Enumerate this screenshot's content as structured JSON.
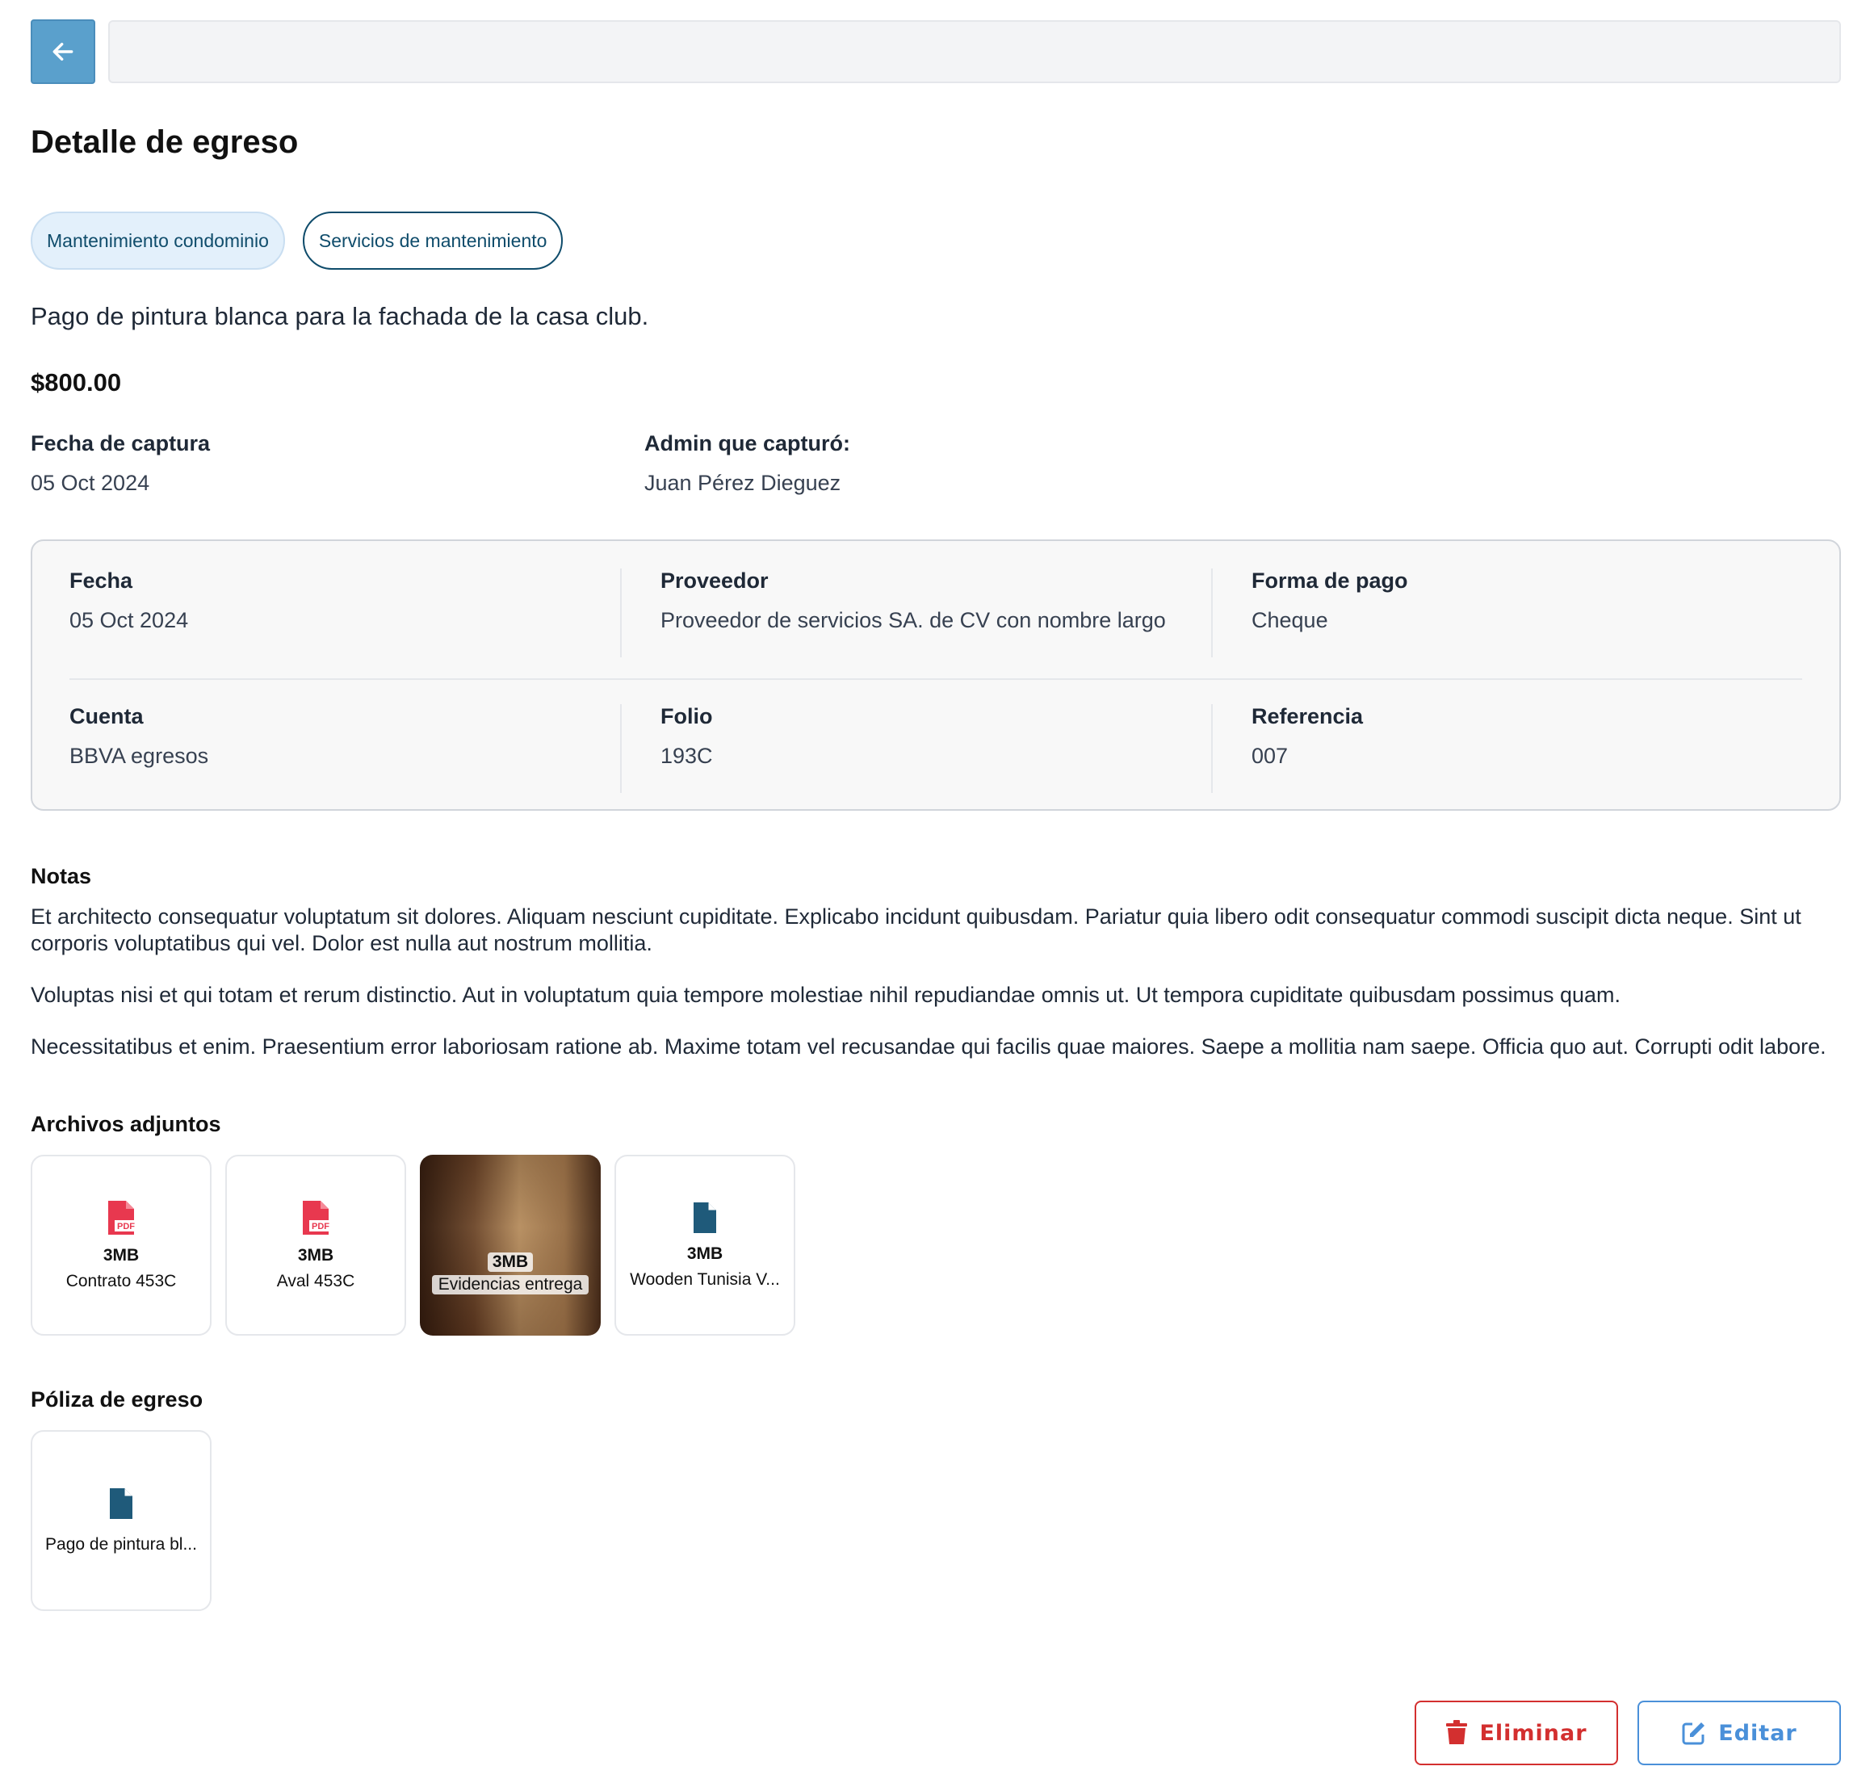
{
  "header": {
    "back_icon": "arrow-left-icon",
    "search_value": ""
  },
  "page_title": "Detalle de egreso",
  "chips": [
    {
      "label": "Mantenimiento condominio"
    },
    {
      "label": "Servicios de mantenimiento"
    }
  ],
  "description": "Pago de pintura blanca para la fachada de la casa club.",
  "amount": "$800.00",
  "meta": {
    "capture_date_label": "Fecha de captura",
    "capture_date_value": "05 Oct 2024",
    "admin_label": "Admin que capturó:",
    "admin_value": "Juan Pérez Dieguez"
  },
  "details": {
    "fecha_label": "Fecha",
    "fecha_value": "05 Oct 2024",
    "proveedor_label": "Proveedor",
    "proveedor_value": "Proveedor de servicios SA. de CV con nombre largo",
    "forma_pago_label": "Forma de pago",
    "forma_pago_value": "Cheque",
    "cuenta_label": "Cuenta",
    "cuenta_value": "BBVA egresos",
    "folio_label": "Folio",
    "folio_value": "193C",
    "referencia_label": "Referencia",
    "referencia_value": "007"
  },
  "notes": {
    "title": "Notas",
    "paragraphs": [
      "Et architecto consequatur voluptatum sit dolores. Aliquam nesciunt cupiditate. Explicabo incidunt quibusdam. Pariatur quia libero odit consequatur commodi suscipit dicta neque. Sint ut corporis voluptatibus qui vel. Dolor est nulla aut nostrum mollitia.",
      "Voluptas nisi et qui totam et rerum distinctio. Aut in voluptatum quia tempore molestiae nihil repudiandae omnis ut. Ut tempora cupiditate quibusdam possimus quam.",
      "Necessitatibus et enim. Praesentium error laboriosam ratione ab. Maxime totam vel recusandae qui facilis quae maiores. Saepe a mollitia nam saepe. Officia quo aut. Corrupti odit labore."
    ]
  },
  "attachments": {
    "title": "Archivos adjuntos",
    "files": [
      {
        "size": "3MB",
        "name": "Contrato 453C",
        "icon": "pdf-icon"
      },
      {
        "size": "3MB",
        "name": "Aval 453C",
        "icon": "pdf-icon"
      },
      {
        "size": "3MB",
        "name": "Evidencias entrega",
        "icon": "image-thumbnail"
      },
      {
        "size": "3MB",
        "name": "Wooden Tunisia V...",
        "icon": "file-icon"
      }
    ]
  },
  "poliza": {
    "title": "Póliza de egreso",
    "files": [
      {
        "name": "Pago de pintura bl...",
        "icon": "file-icon"
      }
    ]
  },
  "actions": {
    "delete_label": "Eliminar",
    "edit_label": "Editar"
  },
  "colors": {
    "accent": "#5aa0cc",
    "chip_text": "#0f4c6b",
    "danger": "#d32f2f",
    "edit": "#4a90d9",
    "pdf": "#e8384f",
    "file": "#1f5a7a"
  }
}
